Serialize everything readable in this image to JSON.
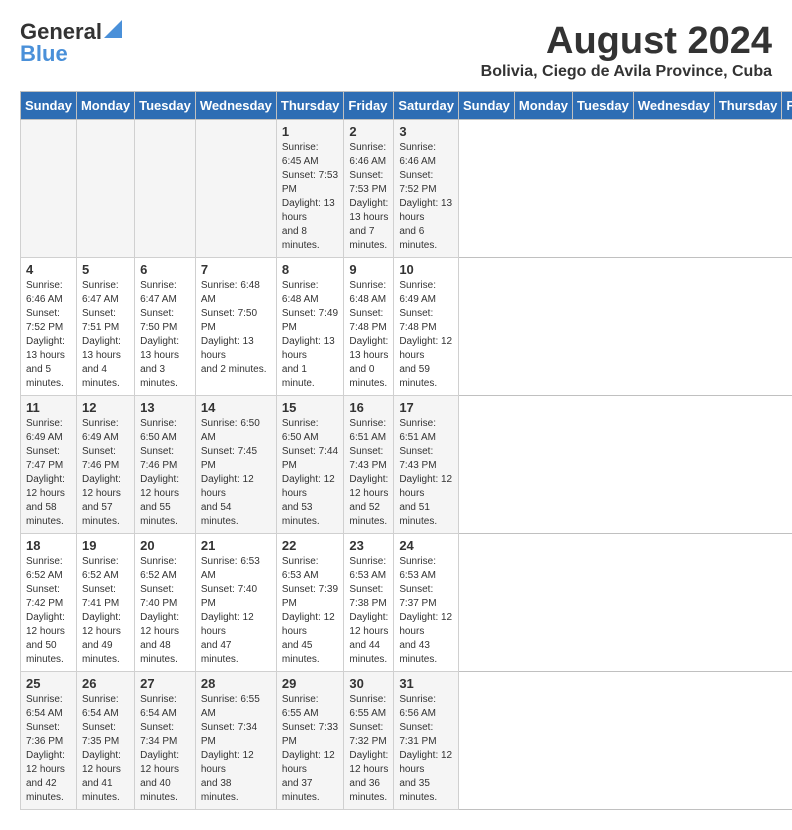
{
  "logo": {
    "general": "General",
    "blue": "Blue"
  },
  "title": {
    "month_year": "August 2024",
    "location": "Bolivia, Ciego de Avila Province, Cuba"
  },
  "days_of_week": [
    "Sunday",
    "Monday",
    "Tuesday",
    "Wednesday",
    "Thursday",
    "Friday",
    "Saturday"
  ],
  "weeks": [
    [
      {
        "day": "",
        "info": ""
      },
      {
        "day": "",
        "info": ""
      },
      {
        "day": "",
        "info": ""
      },
      {
        "day": "",
        "info": ""
      },
      {
        "day": "1",
        "info": "Sunrise: 6:45 AM\nSunset: 7:53 PM\nDaylight: 13 hours\nand 8 minutes."
      },
      {
        "day": "2",
        "info": "Sunrise: 6:46 AM\nSunset: 7:53 PM\nDaylight: 13 hours\nand 7 minutes."
      },
      {
        "day": "3",
        "info": "Sunrise: 6:46 AM\nSunset: 7:52 PM\nDaylight: 13 hours\nand 6 minutes."
      }
    ],
    [
      {
        "day": "4",
        "info": "Sunrise: 6:46 AM\nSunset: 7:52 PM\nDaylight: 13 hours\nand 5 minutes."
      },
      {
        "day": "5",
        "info": "Sunrise: 6:47 AM\nSunset: 7:51 PM\nDaylight: 13 hours\nand 4 minutes."
      },
      {
        "day": "6",
        "info": "Sunrise: 6:47 AM\nSunset: 7:50 PM\nDaylight: 13 hours\nand 3 minutes."
      },
      {
        "day": "7",
        "info": "Sunrise: 6:48 AM\nSunset: 7:50 PM\nDaylight: 13 hours\nand 2 minutes."
      },
      {
        "day": "8",
        "info": "Sunrise: 6:48 AM\nSunset: 7:49 PM\nDaylight: 13 hours\nand 1 minute."
      },
      {
        "day": "9",
        "info": "Sunrise: 6:48 AM\nSunset: 7:48 PM\nDaylight: 13 hours\nand 0 minutes."
      },
      {
        "day": "10",
        "info": "Sunrise: 6:49 AM\nSunset: 7:48 PM\nDaylight: 12 hours\nand 59 minutes."
      }
    ],
    [
      {
        "day": "11",
        "info": "Sunrise: 6:49 AM\nSunset: 7:47 PM\nDaylight: 12 hours\nand 58 minutes."
      },
      {
        "day": "12",
        "info": "Sunrise: 6:49 AM\nSunset: 7:46 PM\nDaylight: 12 hours\nand 57 minutes."
      },
      {
        "day": "13",
        "info": "Sunrise: 6:50 AM\nSunset: 7:46 PM\nDaylight: 12 hours\nand 55 minutes."
      },
      {
        "day": "14",
        "info": "Sunrise: 6:50 AM\nSunset: 7:45 PM\nDaylight: 12 hours\nand 54 minutes."
      },
      {
        "day": "15",
        "info": "Sunrise: 6:50 AM\nSunset: 7:44 PM\nDaylight: 12 hours\nand 53 minutes."
      },
      {
        "day": "16",
        "info": "Sunrise: 6:51 AM\nSunset: 7:43 PM\nDaylight: 12 hours\nand 52 minutes."
      },
      {
        "day": "17",
        "info": "Sunrise: 6:51 AM\nSunset: 7:43 PM\nDaylight: 12 hours\nand 51 minutes."
      }
    ],
    [
      {
        "day": "18",
        "info": "Sunrise: 6:52 AM\nSunset: 7:42 PM\nDaylight: 12 hours\nand 50 minutes."
      },
      {
        "day": "19",
        "info": "Sunrise: 6:52 AM\nSunset: 7:41 PM\nDaylight: 12 hours\nand 49 minutes."
      },
      {
        "day": "20",
        "info": "Sunrise: 6:52 AM\nSunset: 7:40 PM\nDaylight: 12 hours\nand 48 minutes."
      },
      {
        "day": "21",
        "info": "Sunrise: 6:53 AM\nSunset: 7:40 PM\nDaylight: 12 hours\nand 47 minutes."
      },
      {
        "day": "22",
        "info": "Sunrise: 6:53 AM\nSunset: 7:39 PM\nDaylight: 12 hours\nand 45 minutes."
      },
      {
        "day": "23",
        "info": "Sunrise: 6:53 AM\nSunset: 7:38 PM\nDaylight: 12 hours\nand 44 minutes."
      },
      {
        "day": "24",
        "info": "Sunrise: 6:53 AM\nSunset: 7:37 PM\nDaylight: 12 hours\nand 43 minutes."
      }
    ],
    [
      {
        "day": "25",
        "info": "Sunrise: 6:54 AM\nSunset: 7:36 PM\nDaylight: 12 hours\nand 42 minutes."
      },
      {
        "day": "26",
        "info": "Sunrise: 6:54 AM\nSunset: 7:35 PM\nDaylight: 12 hours\nand 41 minutes."
      },
      {
        "day": "27",
        "info": "Sunrise: 6:54 AM\nSunset: 7:34 PM\nDaylight: 12 hours\nand 40 minutes."
      },
      {
        "day": "28",
        "info": "Sunrise: 6:55 AM\nSunset: 7:34 PM\nDaylight: 12 hours\nand 38 minutes."
      },
      {
        "day": "29",
        "info": "Sunrise: 6:55 AM\nSunset: 7:33 PM\nDaylight: 12 hours\nand 37 minutes."
      },
      {
        "day": "30",
        "info": "Sunrise: 6:55 AM\nSunset: 7:32 PM\nDaylight: 12 hours\nand 36 minutes."
      },
      {
        "day": "31",
        "info": "Sunrise: 6:56 AM\nSunset: 7:31 PM\nDaylight: 12 hours\nand 35 minutes."
      }
    ]
  ]
}
